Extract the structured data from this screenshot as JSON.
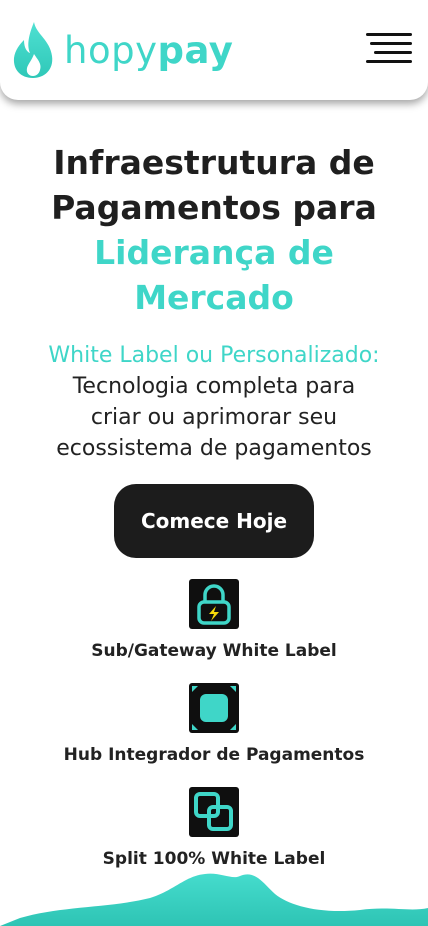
{
  "header": {
    "logo_primary": "hopy",
    "logo_accent": "pay"
  },
  "hero": {
    "title_line1": "Infraestrutura de",
    "title_line2": "Pagamentos para",
    "title_accent_line1": "Liderança de",
    "title_accent_line2": "Mercado"
  },
  "subtitle": {
    "accent": "White Label ou Personalizado:",
    "line1": "Tecnologia completa para",
    "line2": "criar ou aprimorar seu",
    "line3": "ecossistema de pagamentos"
  },
  "cta": {
    "label": "Comece Hoje"
  },
  "features": [
    {
      "label": "Sub/Gateway White Label",
      "icon": "lock-bolt-icon"
    },
    {
      "label": "Hub Integrador de Pagamentos",
      "icon": "hub-square-icon"
    },
    {
      "label": "Split 100% White Label",
      "icon": "split-squares-icon"
    }
  ],
  "colors": {
    "accent": "#3fd6c8",
    "dark": "#1c1c1c",
    "text": "#1f1f1f"
  }
}
